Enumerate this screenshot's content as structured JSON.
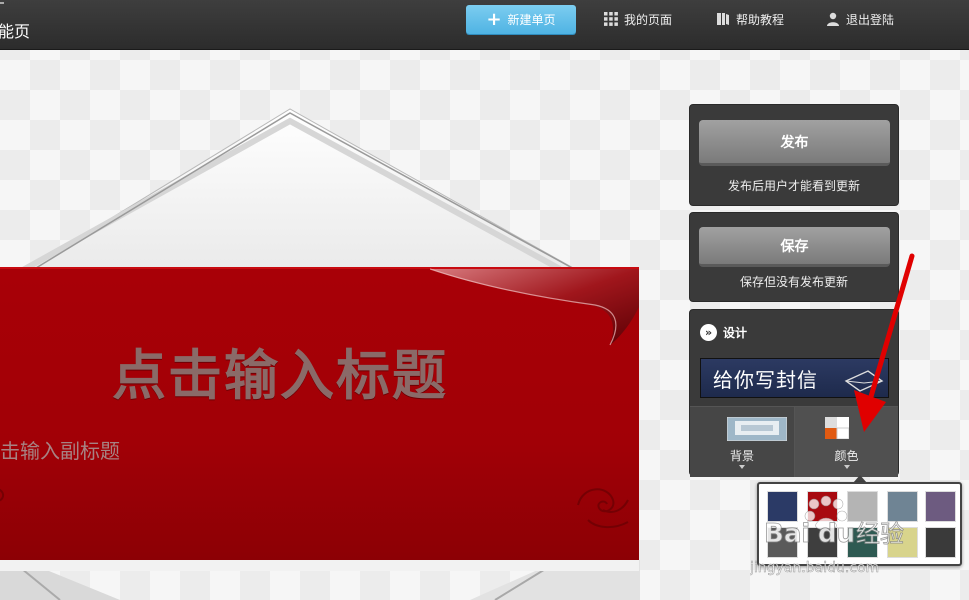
{
  "topbar": {
    "brand": "能页",
    "new_page_label": "新建单页",
    "my_pages_label": "我的页面",
    "help_label": "帮助教程",
    "logout_label": "退出登陆"
  },
  "card": {
    "title": "点击输入标题",
    "subtitle": "击输入副标题"
  },
  "publish": {
    "button_label": "发布",
    "note": "发布后用户才能看到更新"
  },
  "save": {
    "button_label": "保存",
    "note": "保存但没有发布更新"
  },
  "design": {
    "heading": "设计",
    "theme_label": "给你写封信",
    "background_tab": "背景",
    "color_tab": "颜色"
  },
  "swatches": [
    {
      "color": "#2b3a66"
    },
    {
      "color": "#a80a10"
    },
    {
      "color": "#b4b4b4"
    },
    {
      "color": "#6f8494"
    },
    {
      "color": "#6d5b80"
    },
    {
      "color": "#5a5a5a"
    },
    {
      "color": "#3e3e3e"
    },
    {
      "color": "#2e5a52"
    },
    {
      "color": "#d8d48c"
    },
    {
      "color": "#3a3a3a"
    }
  ],
  "watermark": {
    "brand_a": "Bai",
    "brand_b": "du",
    "brand_cn": "经验",
    "url": "jingyan.baidu.com"
  },
  "colors": {
    "topbar": "#333333",
    "accent_blue": "#5cbbe8",
    "card_red": "#a30006",
    "annotation_red": "#e00000"
  }
}
